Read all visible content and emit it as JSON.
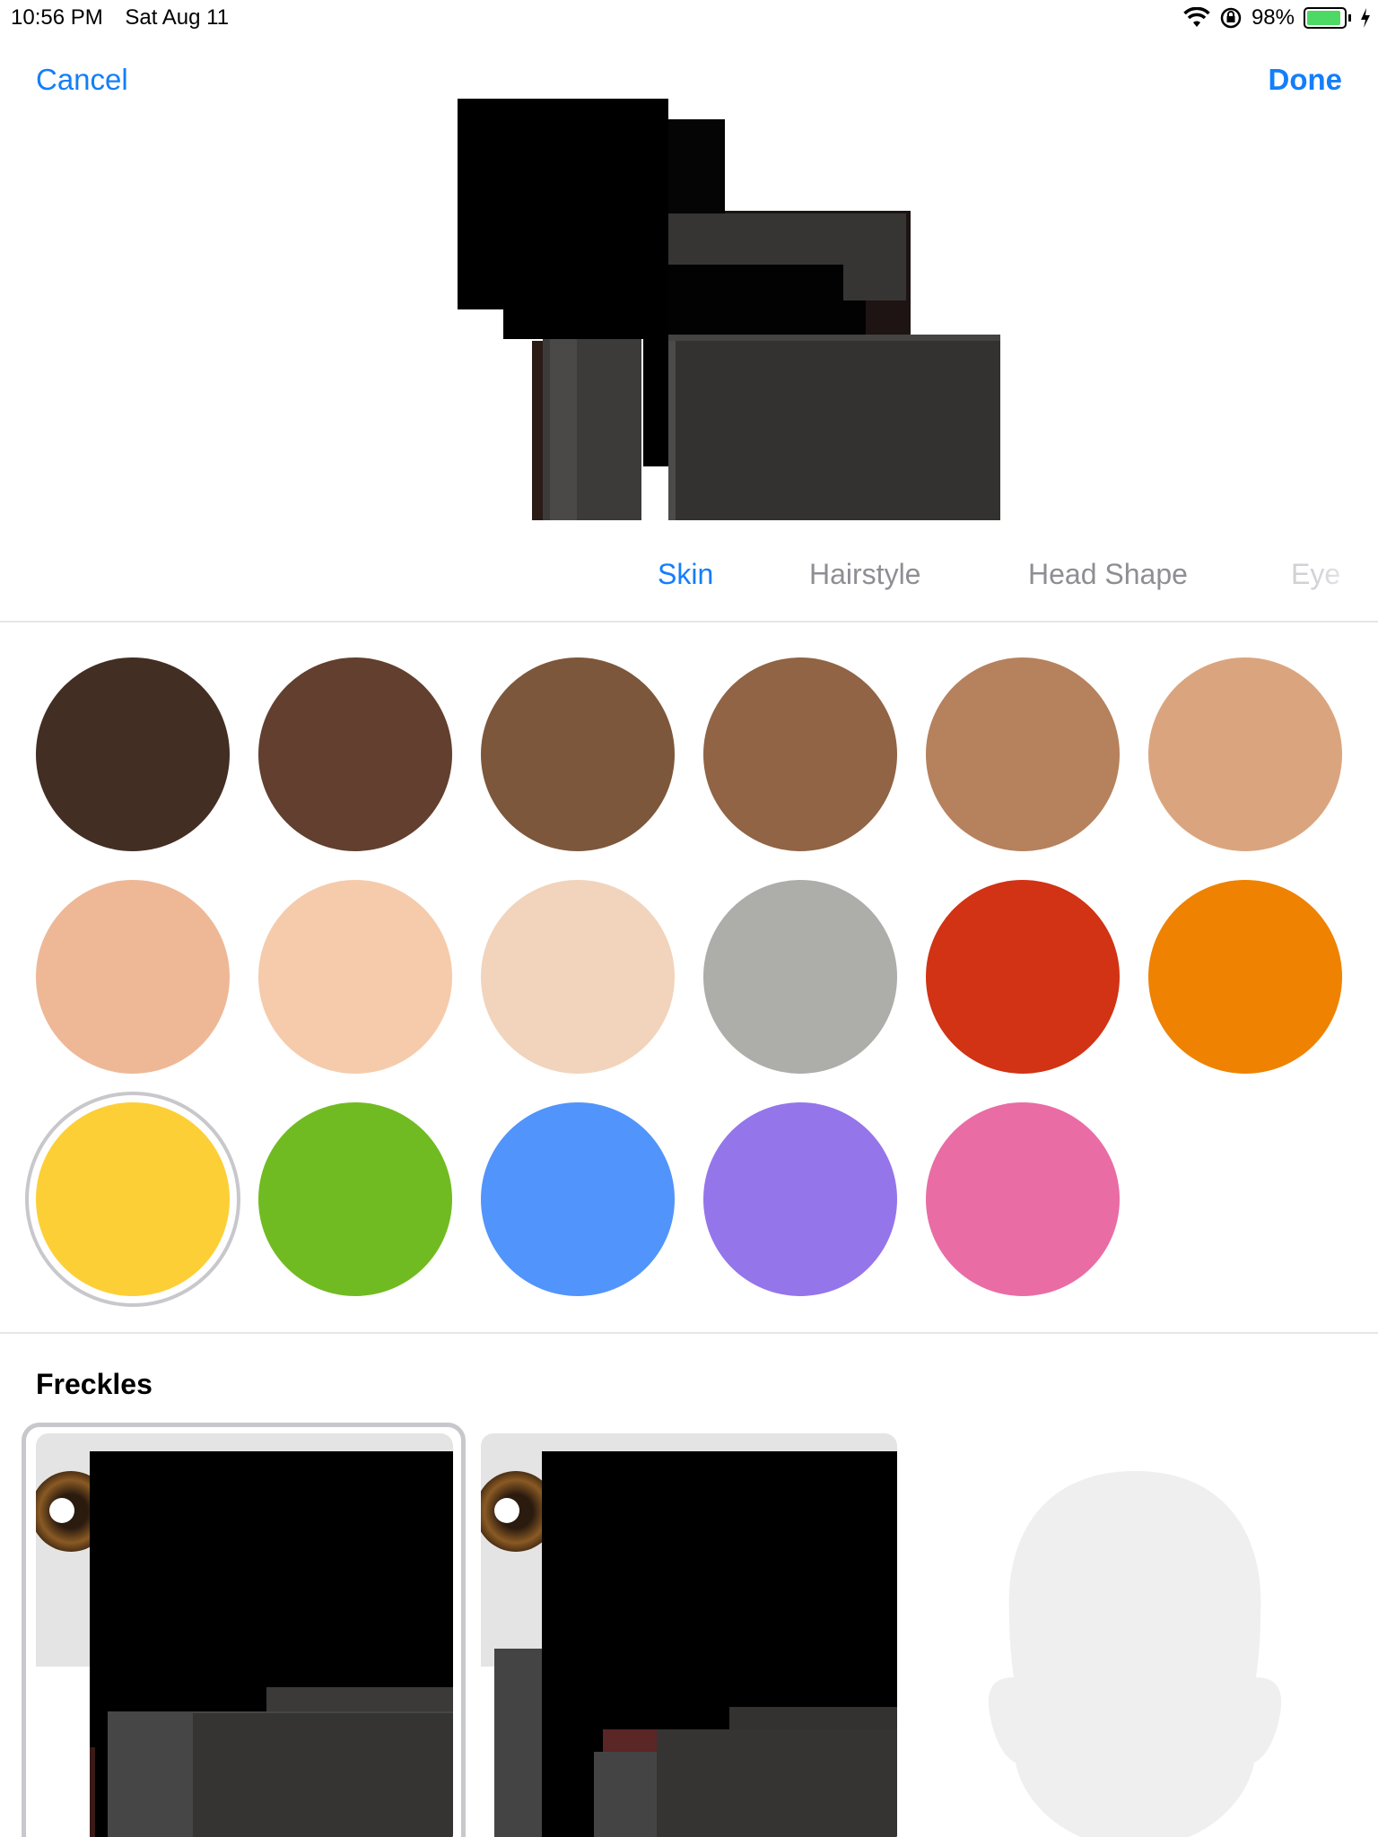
{
  "status_bar": {
    "time": "10:56 PM",
    "date": "Sat Aug 11",
    "battery_percent": "98%",
    "battery_level": 0.98,
    "icons": [
      "wifi-icon",
      "rotation-lock-icon",
      "battery-icon",
      "charging-bolt-icon"
    ]
  },
  "nav": {
    "cancel_label": "Cancel",
    "done_label": "Done"
  },
  "tabs": [
    {
      "label": "Skin",
      "active": true
    },
    {
      "label": "Hairstyle",
      "active": false
    },
    {
      "label": "Head Shape",
      "active": false
    },
    {
      "label": "Eyes",
      "active": false,
      "visible_text": "Eye"
    }
  ],
  "skin_colors": {
    "selected": "#fdcf36",
    "swatches": [
      "#432e23",
      "#623f2e",
      "#7d573b",
      "#906444",
      "#b6815d",
      "#daa57e",
      "#eeb897",
      "#f5cbab",
      "#f1d4bb",
      "#adaeaa",
      "#d13314",
      "#ef8200",
      "#fdcf36",
      "#71bb22",
      "#5194fb",
      "#9575ea",
      "#e96ca5"
    ]
  },
  "freckles": {
    "title": "Freckles",
    "options": [
      "freckles-option-none",
      "freckles-option-freckles",
      "freckles-option-blank-head"
    ]
  },
  "colors": {
    "accent": "#147efb",
    "tab_inactive": "#8e8e93",
    "divider": "#e5e5ea",
    "selection_ring": "#c8c8cc"
  }
}
